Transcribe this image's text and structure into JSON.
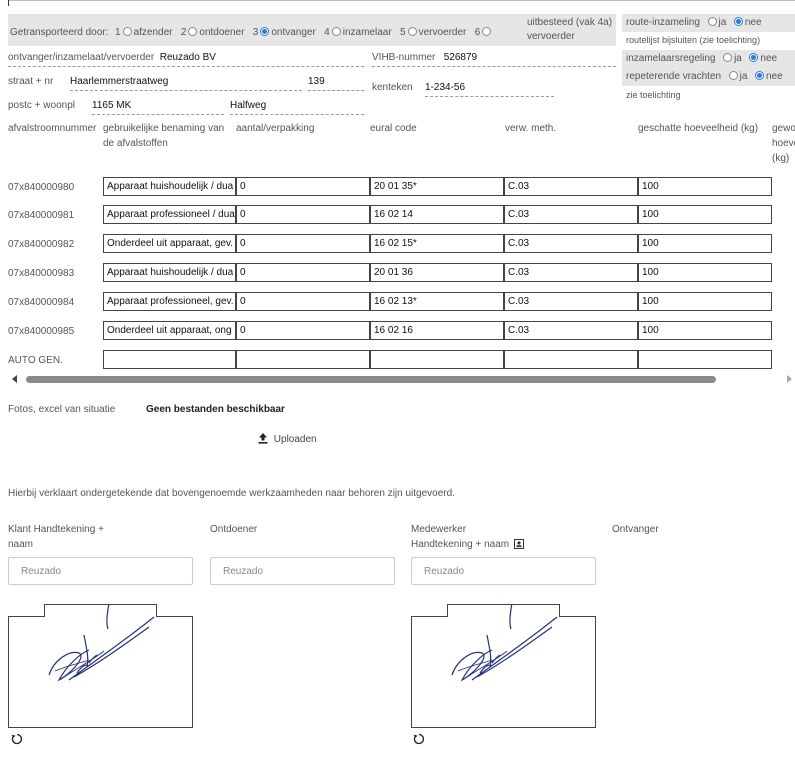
{
  "header": {
    "transported_by_label": "Getransporteerd door:",
    "options": [
      {
        "num": "1",
        "label": "afzender",
        "checked": false
      },
      {
        "num": "2",
        "label": "ontdoener",
        "checked": false
      },
      {
        "num": "3",
        "label": "ontvanger",
        "checked": true
      },
      {
        "num": "4",
        "label": "inzamelaar",
        "checked": false
      },
      {
        "num": "5",
        "label": "vervoerder",
        "checked": false
      },
      {
        "num": "6",
        "label_line1": "uitbesteed (vak 4a)",
        "label_line2": "vervoerder",
        "checked": false
      }
    ]
  },
  "right_panel": {
    "route_label": "route-inzameling",
    "route_ja": "ja",
    "route_nee": "nee",
    "route_note": "routelijst bijsluiten (zie toelichting)",
    "inzamelaar_label": "inzamelaarsregeling",
    "inzamelaar_ja": "ja",
    "inzamelaar_nee": "nee",
    "repeterend_label": "repeterende vrachten",
    "repeterend_ja": "ja",
    "repeterend_nee": "nee",
    "toelichting": "zie toelichting"
  },
  "fields": {
    "ontvanger_label": "ontvanger/inzamelaat/vervoerder",
    "ontvanger_value": "Reuzado BV",
    "vihb_label": "VIHB-nummer",
    "vihb_value": "526879",
    "straat_label": "straat + nr",
    "straat_value": "Haarlemmerstraatweg",
    "huisnr_value": "139",
    "kenteken_label": "kenteken",
    "kenteken_value": "1-234-56",
    "postc_label": "postc + woonpl",
    "postc_value": "1165 MK",
    "woonpl_value": "Halfweg"
  },
  "table": {
    "headers": {
      "nummer": "afvalstroomnummer",
      "benaming_l1": "gebruikelijke benaming van",
      "benaming_l2": "de afvalstoffen",
      "aantal": "aantal/verpakking",
      "eural": "eural code",
      "verw": "verw. meth.",
      "geschatte": "geschatte hoeveelheid (kg)",
      "gewogen_l1": "gewogen",
      "gewogen_l2": "hoeveelheid",
      "gewogen_l3": "(kg)"
    },
    "rows": [
      {
        "nr": "07x840000980",
        "benaming": "Apparaat huishoudelijk / dua",
        "aantal": "0",
        "eural": "20 01 35*",
        "verw": "C.03",
        "hoeveel": "100"
      },
      {
        "nr": "07x840000981",
        "benaming": "Apparaat professioneel / dua",
        "aantal": "0",
        "eural": "16 02 14",
        "verw": "C.03",
        "hoeveel": "100"
      },
      {
        "nr": "07x840000982",
        "benaming": "Onderdeel uit apparaat, gev.",
        "aantal": "0",
        "eural": "16 02 15*",
        "verw": "C.03",
        "hoeveel": "100"
      },
      {
        "nr": "07x840000983",
        "benaming": "Apparaat huishoudelijk / dua",
        "aantal": "0",
        "eural": "20 01 36",
        "verw": "C.03",
        "hoeveel": "100"
      },
      {
        "nr": "07x840000984",
        "benaming": "Apparaat professioneel, gev.",
        "aantal": "0",
        "eural": "16 02 13*",
        "verw": "C.03",
        "hoeveel": "100"
      },
      {
        "nr": "07x840000985",
        "benaming": "Onderdeel uit apparaat, ong",
        "aantal": "0",
        "eural": "16 02 16",
        "verw": "C.03",
        "hoeveel": "100"
      },
      {
        "nr": "AUTO GEN.",
        "benaming": "",
        "aantal": "",
        "eural": "",
        "verw": "",
        "hoeveel": ""
      }
    ]
  },
  "attachments": {
    "label": "Fotos, excel van situatie",
    "status": "Geen bestanden beschikbaar",
    "upload": "Uploaden"
  },
  "declaration": "Hierbij verklaart ondergetekende dat bovengenoemde werkzaamheden naar behoren zijn uitgevoerd.",
  "signatures": {
    "klant_l1": "Klant Handtekening +",
    "klant_l2": "naam",
    "ontdoener": "Ontdoener",
    "medewerker_l1": "Medewerker",
    "medewerker_l2": "Handtekening + naam",
    "ontvanger": "Ontvanger",
    "klant_placeholder": "Reuzado",
    "ontdoener_placeholder": "Reuzado",
    "medewerker_placeholder": "Reuzado"
  }
}
